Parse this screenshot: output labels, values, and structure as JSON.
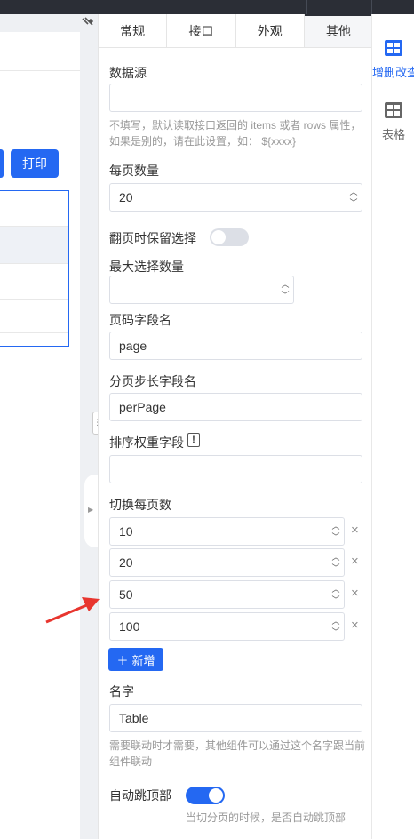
{
  "panel": {
    "tabs": [
      {
        "label": "常规"
      },
      {
        "label": "接口"
      },
      {
        "label": "外观"
      },
      {
        "label": "其他"
      }
    ],
    "data_source": {
      "label": "数据源",
      "value": "",
      "help": "不填写，默认读取接口返回的 items 或者 rows 属性，如果是别的，请在此设置，如： ${xxxx}"
    },
    "per_page": {
      "label": "每页数量",
      "value": "20"
    },
    "keep_selection": {
      "label": "翻页时保留选择",
      "on": false
    },
    "max_select": {
      "label": "最大选择数量",
      "value": ""
    },
    "page_field": {
      "label": "页码字段名",
      "value": "page"
    },
    "per_page_field": {
      "label": "分页步长字段名",
      "value": "perPage"
    },
    "order_weight": {
      "label": "排序权重字段",
      "value": ""
    },
    "switch_per_page": {
      "label": "切换每页数",
      "options": [
        "10",
        "20",
        "50",
        "100"
      ],
      "add_label": "新增"
    },
    "name": {
      "label": "名字",
      "value": "Table",
      "help": "需要联动时才需要，其他组件可以通过这个名字跟当前组件联动"
    },
    "auto_jump_top": {
      "label": "自动跳顶部",
      "on": true,
      "help": "当切分页的时候，是否自动跳顶部"
    }
  },
  "canvas": {
    "print_label": "打印"
  },
  "right_strip": {
    "items": [
      {
        "label": "增删改查",
        "icon": "crud-icon",
        "color": "#2468f2"
      },
      {
        "label": "表格",
        "icon": "table-icon",
        "color": "#666666"
      }
    ]
  },
  "colors": {
    "accent": "#2468f2",
    "annotation_arrow": "#e8352e"
  }
}
